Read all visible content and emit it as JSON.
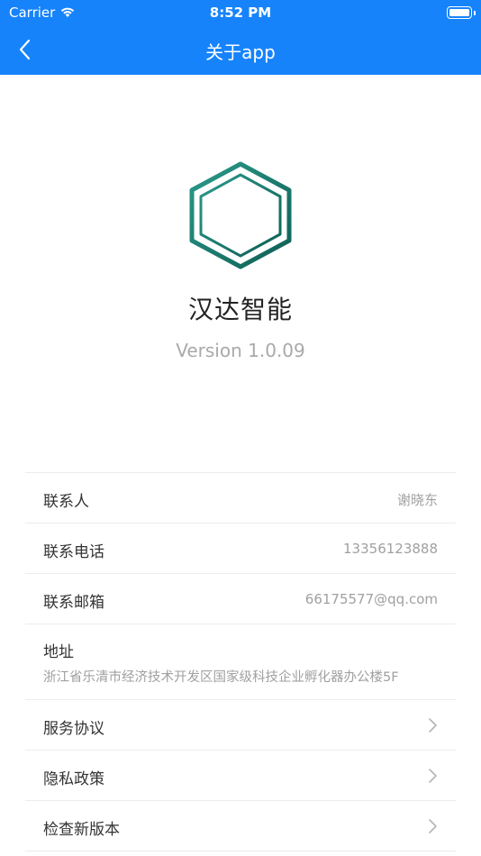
{
  "status_bar": {
    "carrier": "Carrier",
    "time": "8:52 PM"
  },
  "nav": {
    "title": "关于app",
    "back_icon": "chevron-left-icon"
  },
  "app": {
    "name": "汉达智能",
    "version": "Version 1.0.09",
    "logo_color": "#1a7a6e"
  },
  "info": {
    "contact_label": "联系人",
    "contact_value": "谢晓东",
    "phone_label": "联系电话",
    "phone_value": "13356123888",
    "email_label": "联系邮箱",
    "email_value": "66175577@qq.com",
    "address_label": "地址",
    "address_value": "浙江省乐清市经济技术开发区国家级科技企业孵化器办公楼5F"
  },
  "links": {
    "service_label": "服务协议",
    "privacy_label": "隐私政策",
    "update_label": "检查新版本"
  },
  "colors": {
    "header_blue": "#1683fb",
    "divider": "#ececec",
    "muted_text": "#a0a0a0"
  }
}
